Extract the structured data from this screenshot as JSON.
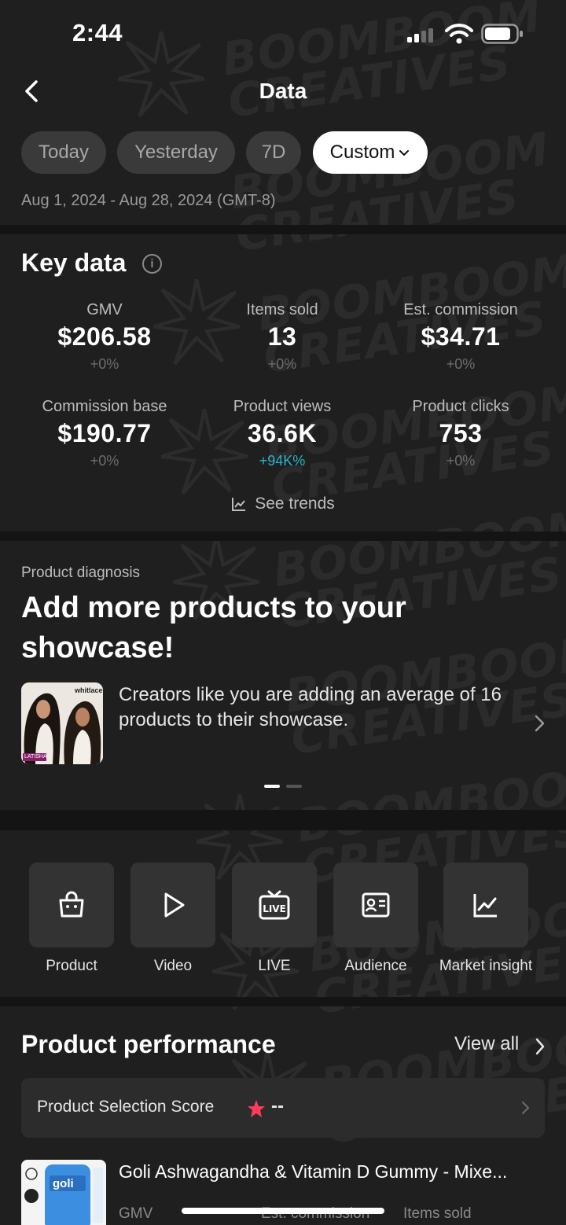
{
  "status_bar": {
    "time": "2:44"
  },
  "header": {
    "title": "Data"
  },
  "date_filter": {
    "options": [
      "Today",
      "Yesterday",
      "7D",
      "Custom"
    ],
    "active": "Custom",
    "range": "Aug 1, 2024 - Aug 28, 2024 (GMT-8)"
  },
  "key_data": {
    "title": "Key data",
    "metrics": [
      {
        "label": "GMV",
        "value": "$206.58",
        "change": "+0%"
      },
      {
        "label": "Items sold",
        "value": "13",
        "change": "+0%"
      },
      {
        "label": "Est. commission",
        "value": "$34.71",
        "change": "+0%"
      },
      {
        "label": "Commission base",
        "value": "$190.77",
        "change": "+0%"
      },
      {
        "label": "Product views",
        "value": "36.6K",
        "change": "+94K%"
      },
      {
        "label": "Product clicks",
        "value": "753",
        "change": "+0%"
      }
    ],
    "see_trends": "See trends"
  },
  "diagnosis": {
    "label": "Product diagnosis",
    "title": "Add more products to your showcase!",
    "text": "Creators like you are adding an average of 16 products to their showcase.",
    "image_text": "LATISHA",
    "brand_text": "whitlace"
  },
  "tools": [
    {
      "label": "Product",
      "icon": "shopping-bag-icon"
    },
    {
      "label": "Video",
      "icon": "play-icon"
    },
    {
      "label": "LIVE",
      "icon": "live-tv-icon"
    },
    {
      "label": "Audience",
      "icon": "id-card-icon"
    },
    {
      "label": "Market insight",
      "icon": "line-chart-icon"
    }
  ],
  "product_performance": {
    "title": "Product performance",
    "view_all": "View all",
    "selection_score_label": "Product Selection Score",
    "selection_score_value": "--",
    "product_name": "Goli Ashwagandha & Vitamin D Gummy - Mixe...",
    "columns": [
      "GMV",
      "Est. commission",
      "Items sold"
    ],
    "product_brand": "goli"
  },
  "watermark": {
    "line1": "BOOMBOOM",
    "line2": "CREATIVES"
  },
  "colors": {
    "background": "#1f1f1f",
    "accent_up": "#27b6c8",
    "star": "#ff3b5c"
  }
}
